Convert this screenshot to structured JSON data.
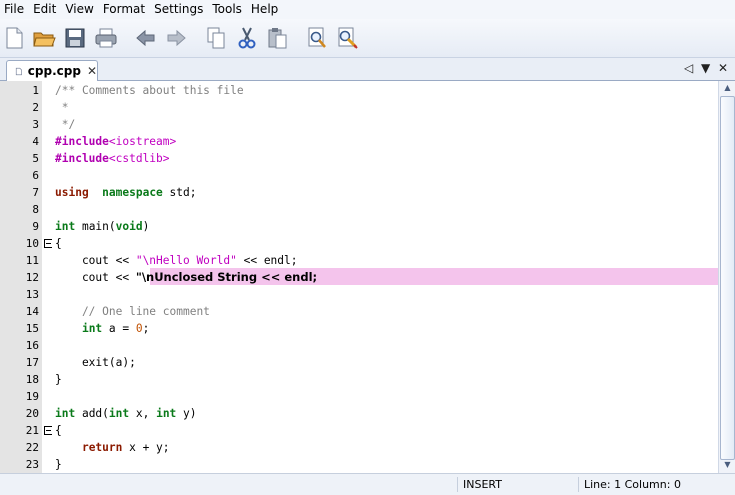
{
  "menu": [
    "File",
    "Edit",
    "View",
    "Format",
    "Settings",
    "Tools",
    "Help"
  ],
  "toolbar": [
    "new-file-icon",
    "open-folder-icon",
    "save-icon",
    "print-icon",
    "undo-icon",
    "redo-icon",
    "copy-icon",
    "cut-icon",
    "paste-icon",
    "find-icon",
    "replace-icon"
  ],
  "tab": {
    "label": "cpp.cpp",
    "close": "✕"
  },
  "tab_controls": {
    "prev": "◁",
    "list": "▼",
    "close": "✕"
  },
  "editor": {
    "line_numbers": [
      "1",
      "2",
      "3",
      "4",
      "5",
      "6",
      "7",
      "8",
      "9",
      "10",
      "11",
      "12",
      "13",
      "14",
      "15",
      "16",
      "17",
      "18",
      "19",
      "20",
      "21",
      "22",
      "23"
    ],
    "lines": [
      [
        [
          "cm",
          "/** Comments about this file"
        ]
      ],
      [
        [
          "cm",
          " *"
        ]
      ],
      [
        [
          "cm",
          " */"
        ]
      ],
      [
        [
          "pp",
          "#include"
        ],
        [
          "str",
          "<iostream>"
        ]
      ],
      [
        [
          "pp",
          "#include"
        ],
        [
          "str",
          "<cstdlib>"
        ]
      ],
      [],
      [
        [
          "kw",
          "using"
        ],
        [
          "",
          "  "
        ],
        [
          "tp",
          "namespace"
        ],
        [
          "",
          " std;"
        ]
      ],
      [],
      [
        [
          "tp",
          "int"
        ],
        [
          "",
          " main("
        ],
        [
          "tp",
          "void"
        ],
        [
          "",
          ")"
        ]
      ],
      [
        [
          "",
          "{"
        ]
      ],
      [
        [
          "",
          "    cout << "
        ],
        [
          "str",
          "\"\\nHello World\""
        ],
        [
          "",
          " << endl;"
        ]
      ],
      [
        [
          "",
          "    cout << "
        ],
        [
          "err",
          "\"\\nUnclosed String << endl;"
        ]
      ],
      [],
      [
        [
          "cm",
          "    // One line comment"
        ]
      ],
      [
        [
          "",
          "    "
        ],
        [
          "tp",
          "int"
        ],
        [
          "",
          " a = "
        ],
        [
          "num",
          "0"
        ],
        [
          "",
          ";"
        ]
      ],
      [],
      [
        [
          "",
          "    exit(a);"
        ]
      ],
      [
        [
          "",
          "}"
        ]
      ],
      [],
      [
        [
          "tp",
          "int"
        ],
        [
          "",
          " add("
        ],
        [
          "tp",
          "int"
        ],
        [
          "",
          " x, "
        ],
        [
          "tp",
          "int"
        ],
        [
          "",
          " y)"
        ]
      ],
      [
        [
          "",
          "{"
        ]
      ],
      [
        [
          "",
          "    "
        ],
        [
          "kw",
          "return"
        ],
        [
          "",
          " x + y;"
        ]
      ],
      [
        [
          "",
          "}"
        ]
      ]
    ]
  },
  "status": {
    "mode": "INSERT",
    "position": "Line: 1  Column: 0"
  }
}
